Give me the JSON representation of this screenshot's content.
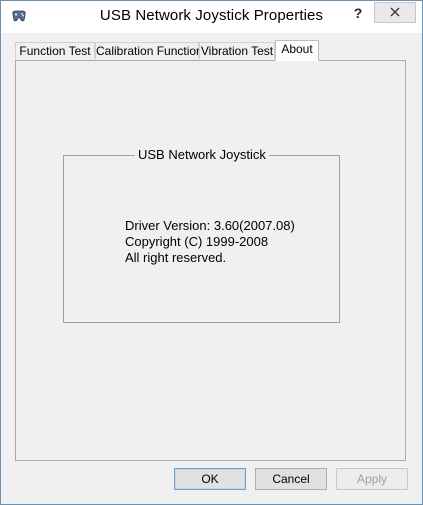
{
  "window": {
    "title": "USB Network Joystick Properties",
    "help_label": "?",
    "icons": {
      "app": "gamepad-icon",
      "close": "close-icon"
    }
  },
  "tabs": [
    {
      "label": "Function Test",
      "active": false
    },
    {
      "label": "Calibration Function",
      "active": false
    },
    {
      "label": "Vibration Test",
      "active": false
    },
    {
      "label": "About",
      "active": true
    }
  ],
  "about": {
    "group_title": "USB Network Joystick",
    "driver_version": "Driver Version: 3.60(2007.08)",
    "copyright": "Copyright (C) 1999-2008",
    "rights": "All right reserved."
  },
  "buttons": {
    "ok": "OK",
    "cancel": "Cancel",
    "apply": "Apply",
    "apply_enabled": false
  }
}
